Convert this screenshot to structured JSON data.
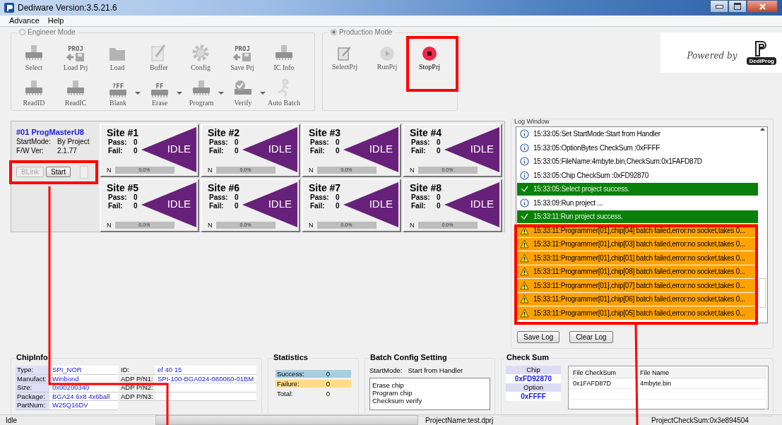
{
  "window": {
    "title": "Dediware Version:3.5.21.6"
  },
  "menu": [
    "Advance",
    "Help"
  ],
  "engineer_mode": {
    "label": "Engineer Mode",
    "selected": false,
    "tools": [
      {
        "label": "Select",
        "kind": "chip",
        "disabled": true,
        "dropdown": false
      },
      {
        "label": "Load Prj",
        "kind": "floppy",
        "badge": "PROJ",
        "disabled": true,
        "dropdown": false
      },
      {
        "label": "Load",
        "kind": "folder",
        "disabled": true,
        "dropdown": false
      },
      {
        "label": "Buffer",
        "kind": "pad",
        "disabled": true,
        "dropdown": false
      },
      {
        "label": "Config",
        "kind": "gear",
        "disabled": true,
        "dropdown": false
      },
      {
        "label": "Save Prj",
        "kind": "floppy",
        "badge": "PROJ",
        "disabled": true,
        "dropdown": false
      },
      {
        "label": "IC Info",
        "kind": "chip",
        "disabled": true,
        "dropdown": false
      },
      {
        "label": "ReadID",
        "kind": "chip",
        "disabled": true,
        "dropdown": false
      },
      {
        "label": "ReadIC",
        "kind": "chip",
        "disabled": true,
        "dropdown": false
      },
      {
        "label": "Blank",
        "kind": "chip",
        "badge": "?FF",
        "disabled": true,
        "dropdown": true
      },
      {
        "label": "Erase",
        "kind": "chip",
        "badge": "FF",
        "disabled": true,
        "dropdown": true
      },
      {
        "label": "Program",
        "kind": "chip",
        "disabled": true,
        "dropdown": true
      },
      {
        "label": "Verify",
        "kind": "check",
        "disabled": true,
        "dropdown": true
      },
      {
        "label": "Auto Batch",
        "kind": "runner",
        "disabled": true,
        "dropdown": false
      }
    ]
  },
  "production_mode": {
    "label": "Production Mode",
    "selected": true,
    "tools": [
      {
        "label": "SelectPrj",
        "kind": "tablet",
        "disabled": true,
        "dropdown": false
      },
      {
        "label": "RunPrj",
        "kind": "play",
        "disabled": true,
        "dropdown": false
      },
      {
        "label": "StopPrj",
        "kind": "stop",
        "disabled": false,
        "dropdown": false
      }
    ]
  },
  "logo": {
    "tagline": "Powered by",
    "brand": "DediProg"
  },
  "programmer": {
    "title": "#01 ProgMasterU8",
    "fields": [
      {
        "label": "StartMode:",
        "value": "By Project"
      },
      {
        "label": "F/W Ver:",
        "value": "2.1.77"
      }
    ],
    "blink_button": {
      "label": "BLink",
      "disabled": true
    },
    "start_button": {
      "label": "Start",
      "disabled": false
    }
  },
  "sites": [
    {
      "name": "Site #1",
      "pass_label": "Pass:",
      "pass": "0",
      "fail_label": "Fail:",
      "fail": "0",
      "status": "IDLE",
      "mode": "N",
      "progress": "0.0%",
      "level": 0
    },
    {
      "name": "Site #2",
      "pass_label": "Pass:",
      "pass": "0",
      "fail_label": "Fail:",
      "fail": "0",
      "status": "IDLE",
      "mode": "N",
      "progress": "0.0%",
      "level": 0
    },
    {
      "name": "Site #3",
      "pass_label": "Pass:",
      "pass": "0",
      "fail_label": "Fail:",
      "fail": "0",
      "status": "IDLE",
      "mode": "N",
      "progress": "0.0%",
      "level": 0
    },
    {
      "name": "Site #4",
      "pass_label": "Pass:",
      "pass": "0",
      "fail_label": "Fail:",
      "fail": "0",
      "status": "IDLE",
      "mode": "N",
      "progress": "0.0%",
      "level": 0
    },
    {
      "name": "Site #5",
      "pass_label": "Pass:",
      "pass": "0",
      "fail_label": "Fail:",
      "fail": "0",
      "status": "IDLE",
      "mode": "N",
      "progress": "0.0%",
      "level": 0
    },
    {
      "name": "Site #6",
      "pass_label": "Pass:",
      "pass": "0",
      "fail_label": "Fail:",
      "fail": "0",
      "status": "IDLE",
      "mode": "N",
      "progress": "0.0%",
      "level": 0
    },
    {
      "name": "Site #7",
      "pass_label": "Pass:",
      "pass": "0",
      "fail_label": "Fail:",
      "fail": "0",
      "status": "IDLE",
      "mode": "N",
      "progress": "0.0%",
      "level": 0
    },
    {
      "name": "Site #8",
      "pass_label": "Pass:",
      "pass": "0",
      "fail_label": "Fail:",
      "fail": "0",
      "status": "IDLE",
      "mode": "N",
      "progress": "0.0%",
      "level": 0
    }
  ],
  "log_window": {
    "title": "Log Window",
    "entries": [
      {
        "kind": "info",
        "text": "15:33:05:Set StartMode:Start from Handler"
      },
      {
        "kind": "info",
        "text": "15:33:05:OptionBytes CheckSum :0xFFFF"
      },
      {
        "kind": "info",
        "text": "15:33:05:FileName:4mbyte.bin,CheckSum:0x1FAFD87D"
      },
      {
        "kind": "info",
        "text": "15:33:05:Chip CheckSum :0xFD92870"
      },
      {
        "kind": "success",
        "text": "15:33:05:Select project success."
      },
      {
        "kind": "info",
        "text": "15:33:09:Run project  ..."
      },
      {
        "kind": "success",
        "text": "15:33:11:Run project success."
      },
      {
        "kind": "warning",
        "text": "15:33:11:Programmer[01],chip[04] batch failed,error:no socket,takes 0..."
      },
      {
        "kind": "warning",
        "text": "15:33:11:Programmer[01],chip[03] batch failed,error:no socket,takes 0..."
      },
      {
        "kind": "warning",
        "text": "15:33:11:Programmer[01],chip[01] batch failed,error:no socket,takes 0..."
      },
      {
        "kind": "warning",
        "text": "15:33:11:Programmer[01],chip[08] batch failed,error:no socket,takes 0..."
      },
      {
        "kind": "warning",
        "text": "15:33:11:Programmer[01],chip[07] batch failed,error:no socket,takes 0..."
      },
      {
        "kind": "warning",
        "text": "15:33:11:Programmer[01],chip[06] batch failed,error:no socket,takes 0..."
      },
      {
        "kind": "warning",
        "text": "15:33:11:Programmer[01],chip[05] batch failed,error:no socket,takes 0..."
      }
    ],
    "buttons": [
      "Save Log",
      "Clear Log"
    ]
  },
  "chip_info": {
    "title": "ChipInfo",
    "left": [
      {
        "label": "Type:",
        "value": "SPI_NOR"
      },
      {
        "label": "Manufact:",
        "value": "Winbond"
      },
      {
        "label": "Size:",
        "value": "0x00200340"
      },
      {
        "label": "Package:",
        "value": "BGA24 6x8 4x6ball"
      },
      {
        "label": "PartNum:",
        "value": "W25Q16DV"
      }
    ],
    "right": [
      {
        "label": "ID:",
        "value": "ef 40 15"
      },
      {
        "label": "ADP P/N1:",
        "value": "SPI-100-BGA024-080060-01BM"
      },
      {
        "label": "ADP P/N2:"
      },
      {
        "label": "ADP P/N3:"
      }
    ]
  },
  "statistics": {
    "title": "Statistics",
    "rows": [
      {
        "label": "Success:",
        "value": "0",
        "color": "#a6cde0"
      },
      {
        "label": "Failure:",
        "value": "0",
        "color": "#fddc8a"
      },
      {
        "label": "Total:",
        "value": "0"
      }
    ]
  },
  "batch_config": {
    "title": "Batch Config Setting",
    "start_mode_label": "StartMode:",
    "start_mode": "Start from Handler",
    "steps": [
      "Erase chip",
      "Program chip",
      "Checksum verify"
    ]
  },
  "check_sum": {
    "title": "Check Sum",
    "chip_label": "Chip",
    "chip": "0xFD92870",
    "option_label": "Option",
    "option": "0xFFFF",
    "table": {
      "columns": [
        "File CheckSum",
        "File Name"
      ],
      "rows": [
        [
          "0x1FAFD87D",
          "4mbyte.bin"
        ]
      ]
    }
  },
  "status_bar": {
    "state": "Idle",
    "level": 0,
    "project_name": "ProjectName:test.dprj",
    "project_checksum": "ProjectCheckSum:0x3e894504"
  }
}
